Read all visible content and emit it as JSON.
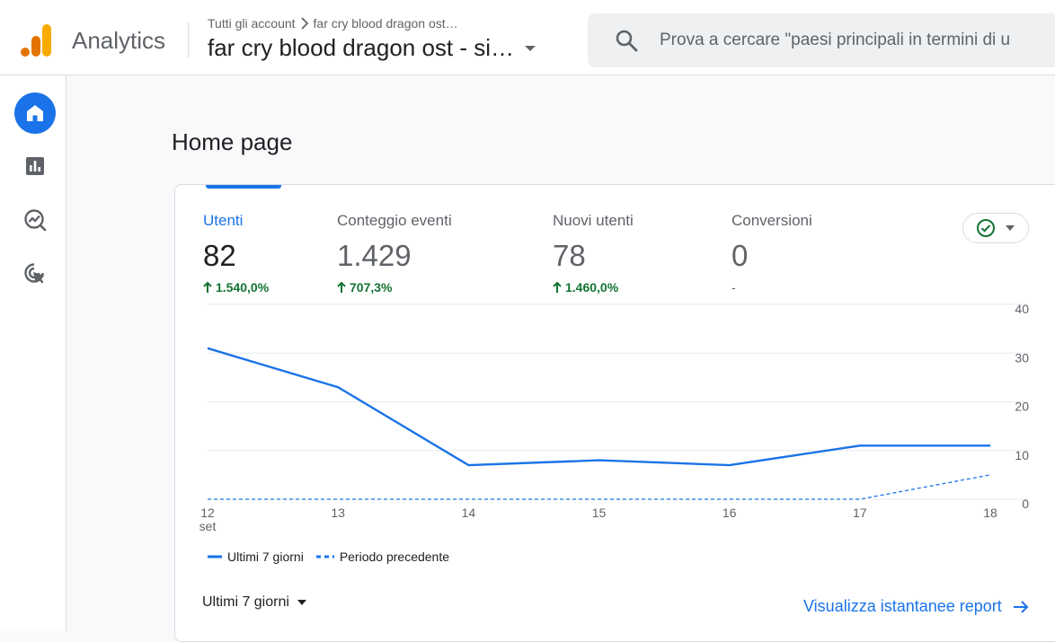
{
  "header": {
    "app_title": "Analytics",
    "breadcrumb": {
      "root": "Tutti gli account",
      "current": "far cry blood dragon ost…"
    },
    "property_name": "far cry blood dragon ost - si…",
    "search_placeholder": "Prova a cercare \"paesi principali in termini di u"
  },
  "sidebar": {
    "items": [
      {
        "icon": "home-icon",
        "active": true
      },
      {
        "icon": "reports-icon",
        "active": false
      },
      {
        "icon": "explore-icon",
        "active": false
      },
      {
        "icon": "advertising-icon",
        "active": false
      }
    ]
  },
  "main": {
    "page_title": "Home page",
    "metrics": [
      {
        "label": "Utenti",
        "value": "82",
        "change": "1.540,0%",
        "active": true
      },
      {
        "label": "Conteggio eventi",
        "value": "1.429",
        "change": "707,3%",
        "active": false
      },
      {
        "label": "Nuovi utenti",
        "value": "78",
        "change": "1.460,0%",
        "active": false
      },
      {
        "label": "Conversioni",
        "value": "0",
        "change": "-",
        "active": false
      }
    ],
    "legend": {
      "current": "Ultimi 7 giorni",
      "previous": "Periodo precedente"
    },
    "date_range": "Ultimi 7 giorni",
    "report_link": "Visualizza istantanee report"
  },
  "colors": {
    "accent": "#1a73e8",
    "positive": "#137333",
    "logo_orange": "#f9ab00",
    "logo_dark": "#e37400"
  },
  "chart_data": {
    "type": "line",
    "x": [
      "12",
      "13",
      "14",
      "15",
      "16",
      "17",
      "18"
    ],
    "x_sublabel": "set",
    "y_ticks": [
      "40",
      "30",
      "20",
      "10",
      "0"
    ],
    "ylim": [
      0,
      40
    ],
    "series": [
      {
        "name": "Ultimi 7 giorni",
        "style": "solid",
        "values": [
          31,
          23,
          7,
          8,
          7,
          11,
          11
        ]
      },
      {
        "name": "Periodo precedente",
        "style": "dashed",
        "values": [
          0,
          0,
          0,
          0,
          0,
          0,
          5
        ]
      }
    ]
  }
}
